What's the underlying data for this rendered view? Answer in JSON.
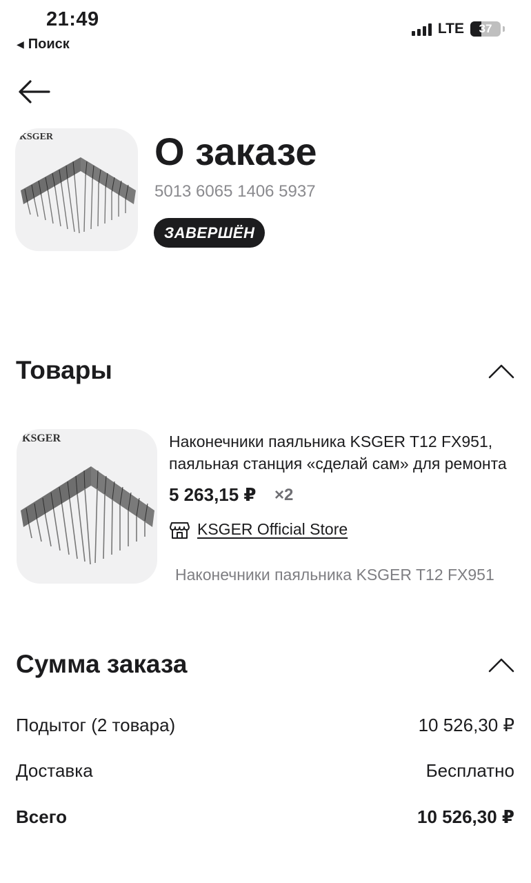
{
  "status_bar": {
    "time": "21:49",
    "back_label": "Поиск",
    "network": "LTE",
    "battery": "37"
  },
  "header": {
    "title": "О заказе",
    "order_number": "5013 6065 1406 5937",
    "status": "ЗАВЕРШЁН",
    "image_brand_text": "KSGER"
  },
  "products_section": {
    "title": "Товары",
    "items": [
      {
        "name_line1": "Наконечники паяльника KSGER T12 FX951,",
        "name_line2": "паяльная станция «сделай сам» для ремонта",
        "price": "5 263,15 ₽",
        "quantity": "×2",
        "store": "KSGER Official Store",
        "variant": "Наконечники паяльника KSGER T12 FX951",
        "image_brand_text": "KSGER"
      }
    ]
  },
  "summary_section": {
    "title": "Сумма заказа",
    "subtotal_label": "Подытог (2 товара)",
    "subtotal_value": "10 526,30 ₽",
    "delivery_label": "Доставка",
    "delivery_value": "Бесплатно",
    "total_label": "Всего",
    "total_value": "10 526,30 ₽"
  },
  "colors": {
    "text": "#1c1c1e",
    "secondary_text": "#8a8a8e",
    "badge_bg": "#1c1c1e",
    "thumb_bg": "#f1f1f2"
  },
  "icons": {
    "back": "arrow-left-icon",
    "collapse": "chevron-up-icon",
    "store": "storefront-icon"
  }
}
